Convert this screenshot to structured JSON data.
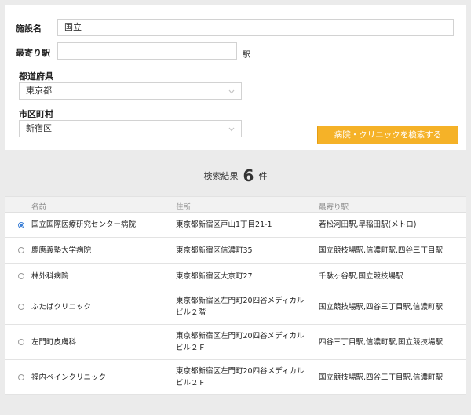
{
  "form": {
    "facility_label": "施設名",
    "facility_value": "国立",
    "station_label": "最寄り駅",
    "station_value": "",
    "station_unit": "駅",
    "pref_label": "都道府県",
    "pref_value": "東京都",
    "city_label": "市区町村",
    "city_value": "新宿区",
    "search_button": "病院・クリニックを検索する"
  },
  "results": {
    "prefix": "検索結果",
    "count": "6",
    "suffix": "件"
  },
  "table": {
    "headers": [
      "名前",
      "住所",
      "最寄り駅"
    ],
    "rows": [
      {
        "selected": true,
        "name": "国立国際医療研究センター病院",
        "address": "東京都新宿区戸山1丁目21-1",
        "station": "若松河田駅,早稲田駅(メトロ)"
      },
      {
        "selected": false,
        "name": "慶應義塾大学病院",
        "address": "東京都新宿区信濃町35",
        "station": "国立競技場駅,信濃町駅,四谷三丁目駅"
      },
      {
        "selected": false,
        "name": "林外科病院",
        "address": "東京都新宿区大京町27",
        "station": "千駄ヶ谷駅,国立競技場駅"
      },
      {
        "selected": false,
        "name": "ふたばクリニック",
        "address": "東京都新宿区左門町20四谷メディカルビル２階",
        "station": "国立競技場駅,四谷三丁目駅,信濃町駅"
      },
      {
        "selected": false,
        "name": "左門町皮膚科",
        "address": "東京都新宿区左門町20四谷メディカルビル２Ｆ",
        "station": "四谷三丁目駅,信濃町駅,国立競技場駅"
      },
      {
        "selected": false,
        "name": "福内ペインクリニック",
        "address": "東京都新宿区左門町20四谷メディカルビル２Ｆ",
        "station": "国立競技場駅,四谷三丁目駅,信濃町駅"
      }
    ]
  },
  "colors": {
    "button": "#f5b228",
    "radio_selected": "#3b7fd6",
    "background": "#ebebeb"
  }
}
